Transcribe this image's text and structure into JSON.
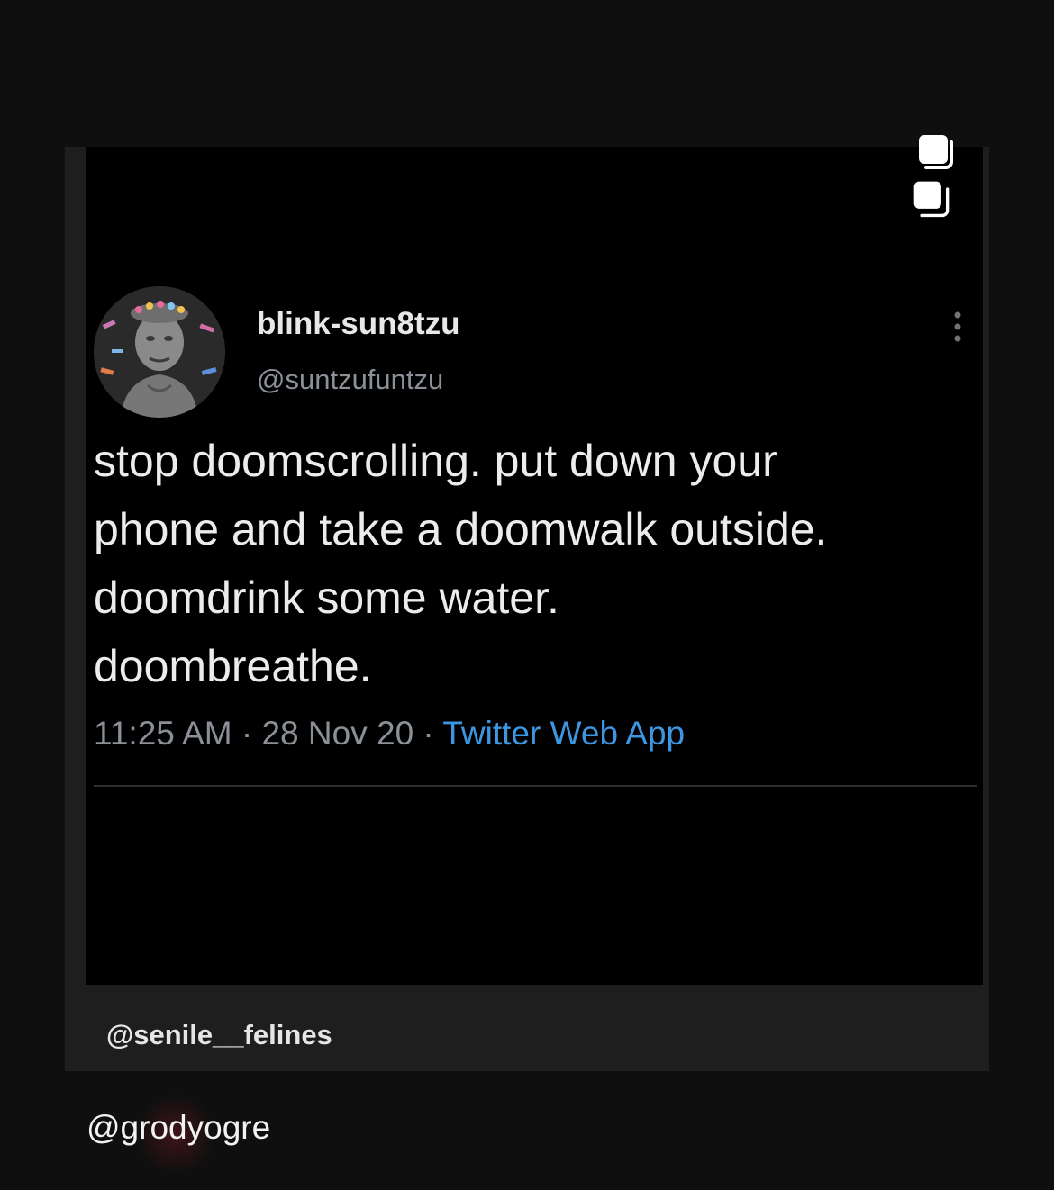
{
  "icons": {
    "multi_post": "multi-post-icon",
    "more": "more-vertical-icon",
    "avatar": "avatar-statue-image"
  },
  "tweet": {
    "display_name": "blink-sun8tzu",
    "handle": "@suntzufuntzu",
    "text": "stop doomscrolling. put down your\nphone and take a doomwalk outside.\ndoomdrink some water.\ndoombreathe.",
    "time": "11:25 AM",
    "date": "28 Nov 20",
    "separator": " · ",
    "source": "Twitter Web App"
  },
  "post": {
    "credit": "@senile__felines",
    "footer_handle": "@grodyogre"
  },
  "colors": {
    "background": "#0f0f0f",
    "card": "#1e1e1e",
    "tweet_bg": "#000000",
    "link_blue": "#3e95e0",
    "muted_gray": "#8b9097"
  }
}
